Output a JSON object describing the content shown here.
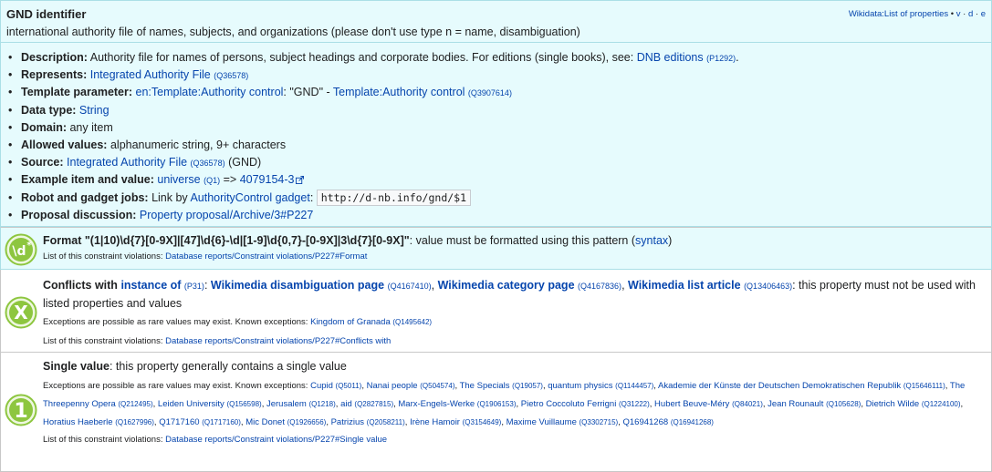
{
  "header": {
    "title": "GND identifier",
    "subtitle": "international authority file of names, subjects, and organizations (please don't use type n = name, disambiguation)",
    "nav_link": "Wikidata:List of properties",
    "nav_v": "v",
    "nav_d": "d",
    "nav_e": "e"
  },
  "props": {
    "description_label": "Description:",
    "description_text": "Authority file for names of persons, subject headings and corporate bodies. For editions (single books), see:",
    "description_link": "DNB editions",
    "description_q": "(P1292)",
    "represents_label": "Represents:",
    "represents_link": "Integrated Authority File",
    "represents_q": "(Q36578)",
    "template_label": "Template parameter:",
    "template_link": "en:Template:Authority control",
    "template_mid": ": \"GND\" -",
    "template_link2": "Template:Authority control",
    "template_q": "(Q3907614)",
    "datatype_label": "Data type:",
    "datatype_link": "String",
    "domain_label": "Domain:",
    "domain_text": "any item",
    "allowed_label": "Allowed values:",
    "allowed_text": "alphanumeric string, 9+ characters",
    "source_label": "Source:",
    "source_link": "Integrated Authority File",
    "source_q": "(Q36578)",
    "source_tail": "(GND)",
    "example_label": "Example item and value:",
    "example_link": "universe",
    "example_q": "(Q1)",
    "example_arrow": "=>",
    "example_value": "4079154-3",
    "robot_label": "Robot and gadget jobs:",
    "robot_text": "Link by",
    "robot_link": "AuthorityControl gadget",
    "robot_colon": ":",
    "robot_code": "http://d-nb.info/gnd/$1",
    "proposal_label": "Proposal discussion:",
    "proposal_link": "Property proposal/Archive/3#P227"
  },
  "format": {
    "label": "Format",
    "pattern": "\"(1|10)\\d{7}[0-9X]|[47]\\d{6}-\\d|[1-9]\\d{0,7}-[0-9X]|3\\d{7}[0-9X]\"",
    "text": ": value must be formatted using this pattern (",
    "syntax_link": "syntax",
    "close": ")",
    "list_text": "List of this constraint violations:",
    "list_link": "Database reports/Constraint violations/P227#Format"
  },
  "conflicts": {
    "label": "Conflicts with",
    "instance_link": "instance of",
    "instance_q": "(P31)",
    "v1": "Wikimedia disambiguation page",
    "v1_q": "(Q4167410)",
    "v2": "Wikimedia category page",
    "v2_q": "(Q4167836)",
    "v3": "Wikimedia list article",
    "v3_q": "(Q13406463)",
    "text": ": this property must not be used with listed properties and values",
    "exceptions_text": "Exceptions are possible as rare values may exist. Known exceptions:",
    "exception_link": "Kingdom of Granada",
    "exception_q": "(Q1495642)",
    "list_text": "List of this constraint violations:",
    "list_link": "Database reports/Constraint violations/P227#Conflicts with"
  },
  "single": {
    "label": "Single value",
    "text": ": this property generally contains a single value",
    "exceptions_text": "Exceptions are possible as rare values may exist. Known exceptions:",
    "exceptions": [
      {
        "name": "Cupid",
        "q": "(Q5011)"
      },
      {
        "name": "Nanai people",
        "q": "(Q504574)"
      },
      {
        "name": "The Specials",
        "q": "(Q19057)"
      },
      {
        "name": "quantum physics",
        "q": "(Q1144457)"
      },
      {
        "name": "Akademie der Künste der Deutschen Demokratischen Republik",
        "q": "(Q15646111)"
      },
      {
        "name": "The Threepenny Opera",
        "q": "(Q212495)"
      },
      {
        "name": "Leiden University",
        "q": "(Q156598)"
      },
      {
        "name": "Jerusalem",
        "q": "(Q1218)"
      },
      {
        "name": "aid",
        "q": "(Q2827815)"
      },
      {
        "name": "Marx-Engels-Werke",
        "q": "(Q1906153)"
      },
      {
        "name": "Pietro Coccoluto Ferrigni",
        "q": "(Q31222)"
      },
      {
        "name": "Hubert Beuve-Méry",
        "q": "(Q84021)"
      },
      {
        "name": "Jean Rounault",
        "q": "(Q105628)"
      },
      {
        "name": "Dietrich Wilde",
        "q": "(Q1224100)"
      },
      {
        "name": "Horatius Haeberle",
        "q": "(Q1627996)"
      },
      {
        "name": "Q1717160",
        "q": "(Q1717160)"
      },
      {
        "name": "Mic Donet",
        "q": "(Q1926656)"
      },
      {
        "name": "Patrizius",
        "q": "(Q2058211)"
      },
      {
        "name": "Irène Hamoir",
        "q": "(Q3154649)"
      },
      {
        "name": "Maxime Vuillaume",
        "q": "(Q3302715)"
      },
      {
        "name": "Q16941268",
        "q": "(Q16941268)"
      }
    ],
    "list_text": "List of this constraint violations:",
    "list_link": "Database reports/Constraint violations/P227#Single value"
  },
  "icons": {
    "format": "regex-format-icon",
    "conflicts": "x-circle-icon",
    "single": "one-circle-icon",
    "external": "external-link-icon"
  },
  "colors": {
    "panel_bg": "#e6fbfd",
    "panel_border": "#aadfe6",
    "link": "#0645ad",
    "icon_green": "#8dc63f"
  }
}
